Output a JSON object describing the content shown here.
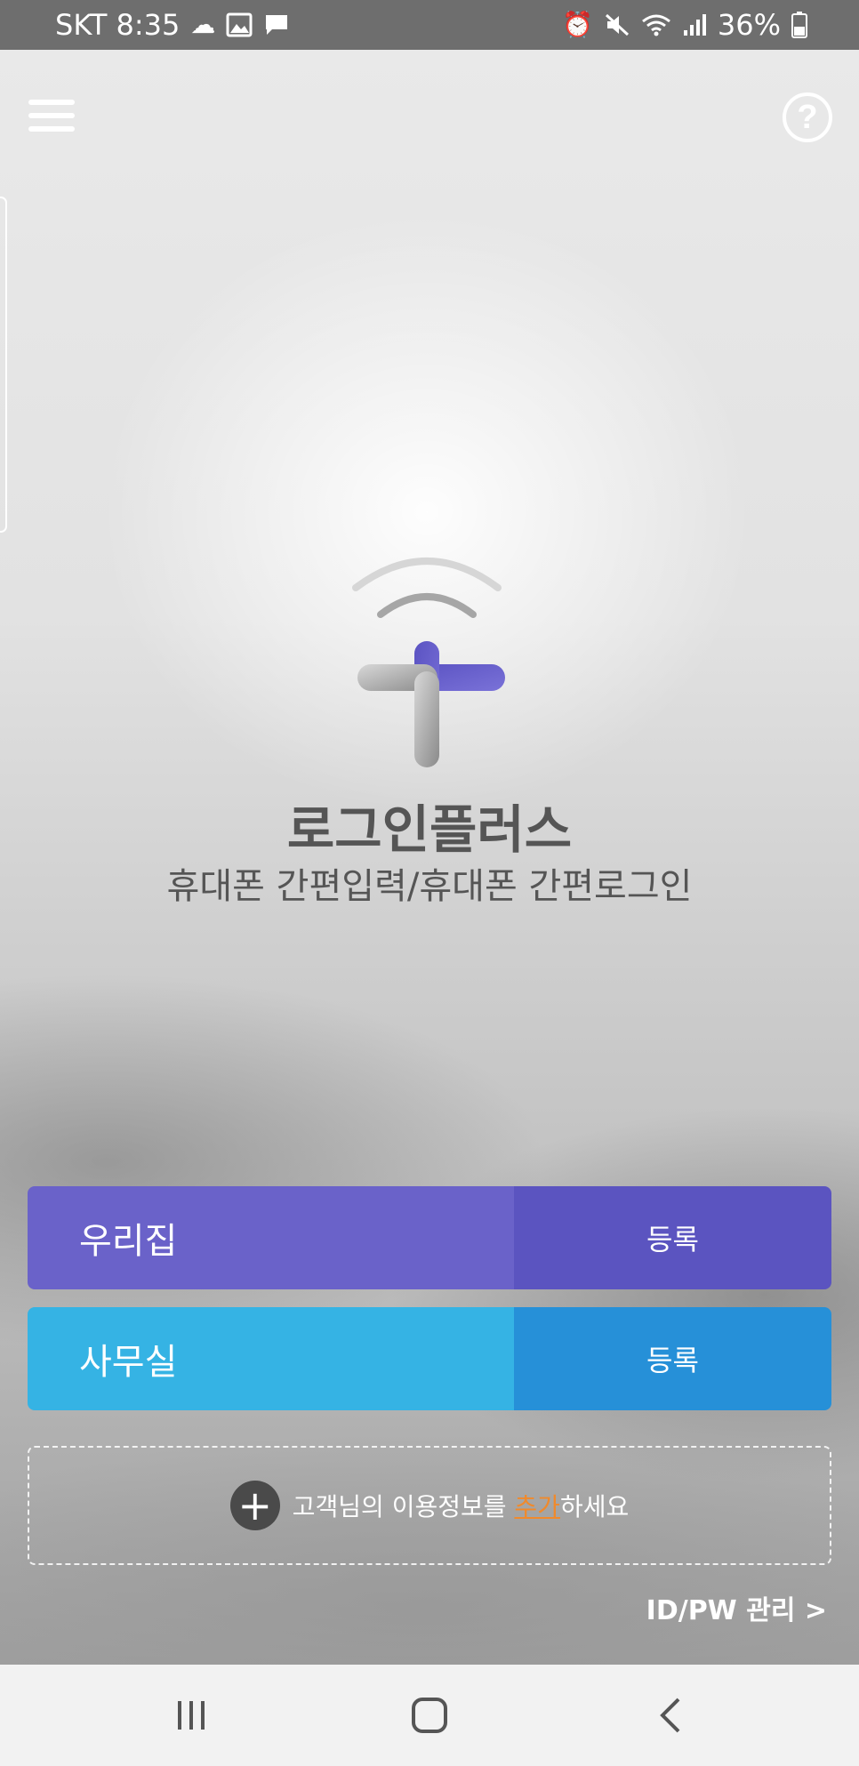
{
  "status_bar": {
    "carrier_time": "SKT 8:35",
    "battery": "36%",
    "left_icons": [
      "cloud-icon",
      "image-icon",
      "message-icon"
    ],
    "right_icons": [
      "alarm-icon",
      "mute-icon",
      "wifi-icon",
      "signal-icon",
      "battery-icon"
    ]
  },
  "header": {
    "menu_icon": "hamburger-menu-icon",
    "help_label": "?"
  },
  "app": {
    "title": "로그인플러스",
    "subtitle": "휴대폰 간편입력/휴대폰 간편로그인"
  },
  "entries": [
    {
      "name": "우리집",
      "action": "등록",
      "color_name": "#6a62c9",
      "color_action": "#5b54c0"
    },
    {
      "name": "사무실",
      "action": "등록",
      "color_name": "#35b3e4",
      "color_action": "#2690d8"
    }
  ],
  "add_info": {
    "before": "고객님의 이용정보를 ",
    "link": "추가",
    "after": "하세요",
    "link_color": "#f08a2c"
  },
  "idpw_link": "ID/PW 관리 >",
  "nav": {
    "recent": "recent-apps-icon",
    "home": "home-icon",
    "back": "back-icon"
  }
}
